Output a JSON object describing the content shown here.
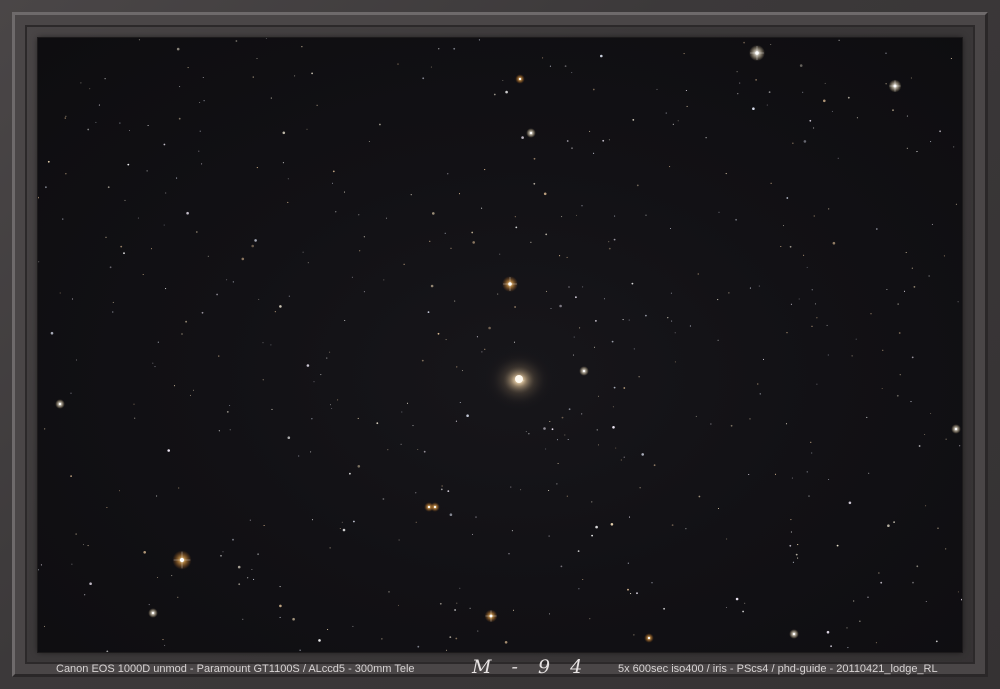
{
  "image": {
    "title": "M - 9 4",
    "caption_left": "Canon EOS 1000D unmod - Paramount GT1100S / ALccd5 - 300mm Tele",
    "caption_right": "5x 600sec iso400 /  iris - PScs4  /  phd-guide - 20110421_lodge_RL"
  },
  "colors": {
    "frame": "#3c393a",
    "sky": "#121115",
    "caption_text": "#d8d4d4"
  }
}
